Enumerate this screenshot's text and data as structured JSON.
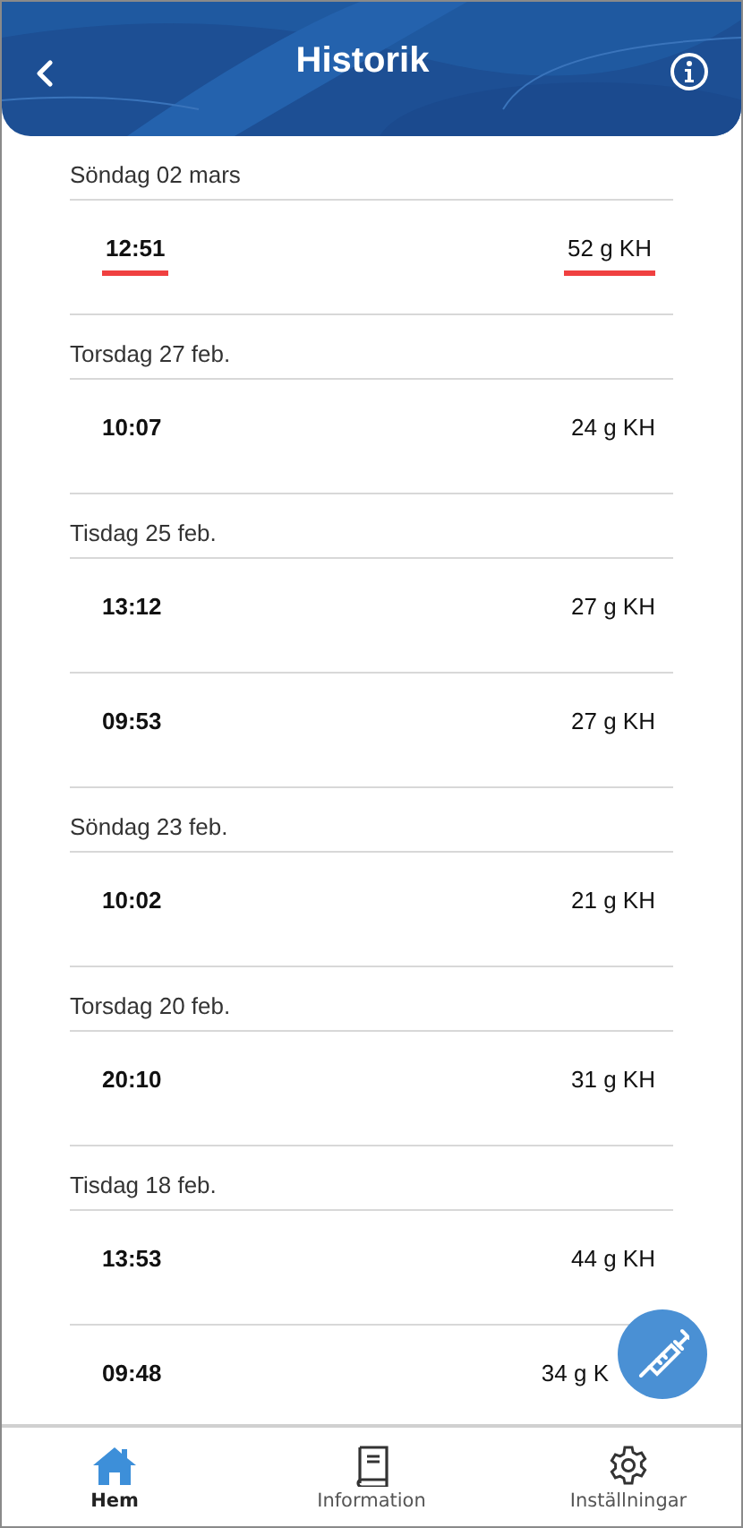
{
  "header": {
    "title": "Historik"
  },
  "days": [
    {
      "date": "Söndag 02 mars",
      "entries": [
        {
          "time": "12:51",
          "amount": "52 g KH",
          "highlighted": true
        }
      ]
    },
    {
      "date": "Torsdag 27 feb.",
      "entries": [
        {
          "time": "10:07",
          "amount": "24 g KH",
          "highlighted": false
        }
      ]
    },
    {
      "date": "Tisdag 25 feb.",
      "entries": [
        {
          "time": "13:12",
          "amount": "27 g KH",
          "highlighted": false
        },
        {
          "time": "09:53",
          "amount": "27 g KH",
          "highlighted": false
        }
      ]
    },
    {
      "date": "Söndag 23 feb.",
      "entries": [
        {
          "time": "10:02",
          "amount": "21 g KH",
          "highlighted": false
        }
      ]
    },
    {
      "date": "Torsdag 20 feb.",
      "entries": [
        {
          "time": "20:10",
          "amount": "31 g KH",
          "highlighted": false
        }
      ]
    },
    {
      "date": "Tisdag 18 feb.",
      "entries": [
        {
          "time": "13:53",
          "amount": "44 g KH",
          "highlighted": false
        },
        {
          "time": "09:48",
          "amount": "34 g K",
          "highlighted": false
        }
      ]
    }
  ],
  "nav": [
    {
      "label": "Hem",
      "selected": true
    },
    {
      "label": "Information",
      "selected": false
    },
    {
      "label": "Inställningar",
      "selected": false
    }
  ]
}
